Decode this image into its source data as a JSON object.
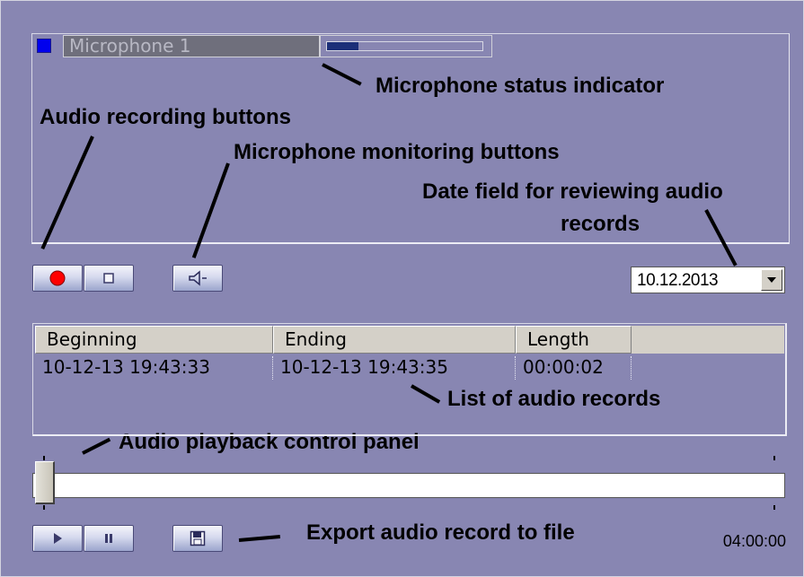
{
  "microphone": {
    "name": "Microphone 1",
    "indicator_color": "#0000ee",
    "level_fraction": 0.2
  },
  "annotations": {
    "status_indicator": "Microphone status indicator",
    "recording_buttons": "Audio recording buttons",
    "monitoring_buttons": "Microphone monitoring buttons",
    "date_field_line1": "Date field for reviewing audio",
    "date_field_line2": "records",
    "records_list": "List of audio records",
    "playback_panel": "Audio playback control panel",
    "export": "Export audio record to file"
  },
  "controls": {
    "record_icon": "record-icon",
    "stop_icon": "stop-icon",
    "speaker_icon": "speaker-icon",
    "play_icon": "play-icon",
    "pause_icon": "pause-icon",
    "save_icon": "save-icon"
  },
  "date_field": {
    "value": "10.12.2013"
  },
  "records": {
    "columns": [
      "Beginning",
      "Ending",
      "Length"
    ],
    "rows": [
      [
        "10-12-13 19:43:33",
        "10-12-13 19:43:35",
        "00:00:02"
      ]
    ]
  },
  "playback": {
    "position_fraction": 0.0,
    "duration": "04:00:00"
  },
  "colors": {
    "panel_bg": "#8886b2",
    "record_red": "#ff0000",
    "level_fill": "#1c2e78"
  }
}
